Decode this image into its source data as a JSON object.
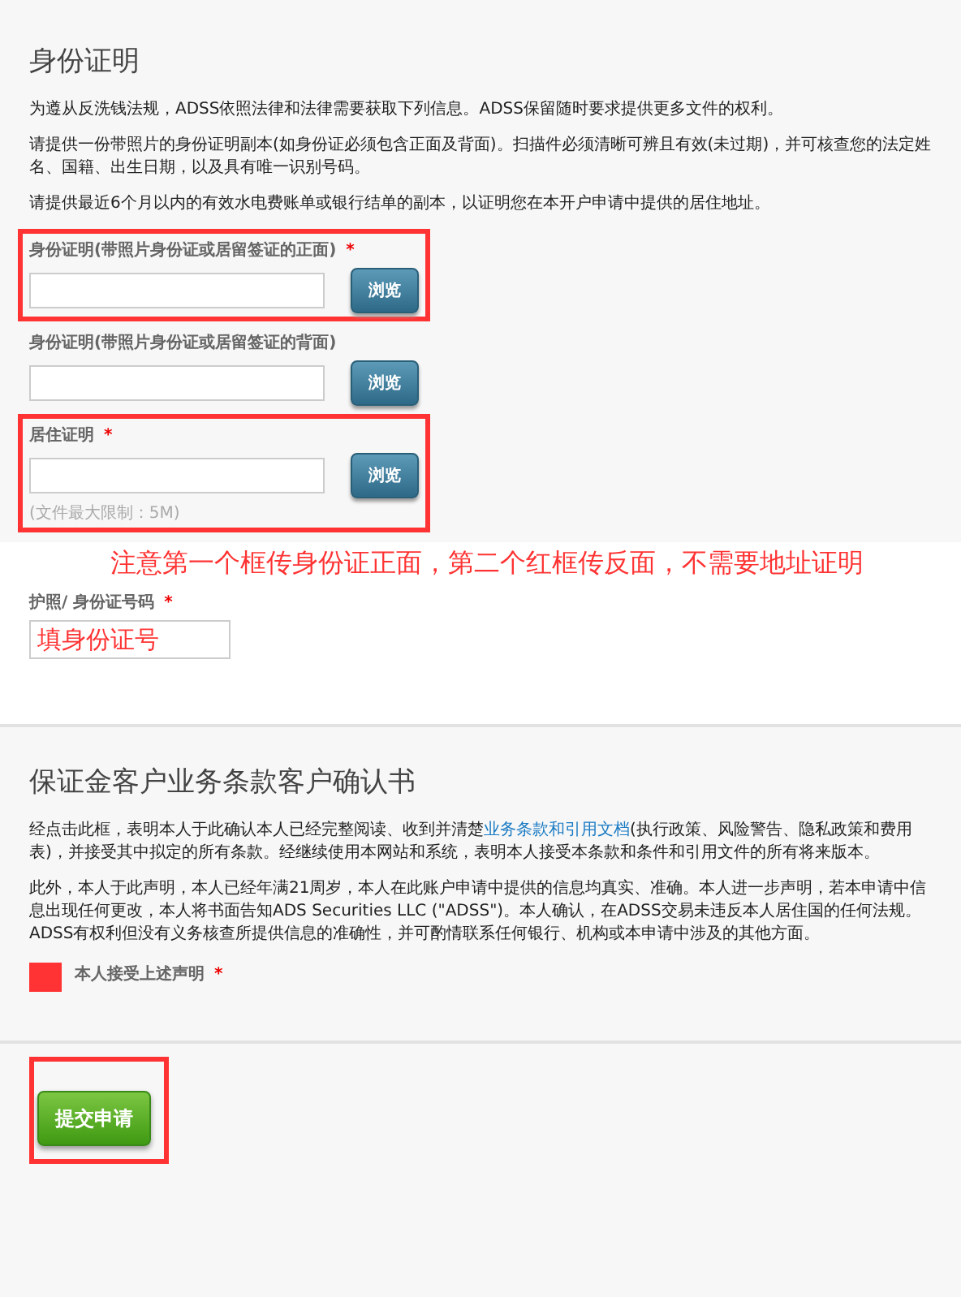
{
  "identity_section": {
    "title": "身份证明",
    "paragraphs": [
      "为遵从反洗钱法规，ADSS依照法律和法律需要获取下列信息。ADSS保留随时要求提供更多文件的权利。",
      "请提供一份带照片的身份证明副本(如身份证必须包含正面及背面)。扫描件必须清晰可辨且有效(未过期)，并可核查您的法定姓名、国籍、出生日期，以及具有唯一识别号码。",
      "请提供最近6个月以内的有效水电费账单或银行结单的副本，以证明您在本开户申请中提供的居住地址。"
    ],
    "uploads": [
      {
        "label": "身份证明(带照片身份证或居留签证的正面)",
        "required": true,
        "button": "浏览",
        "highlighted": true
      },
      {
        "label": "身份证明(带照片身份证或居留签证的背面)",
        "required": false,
        "button": "浏览",
        "highlighted": false
      },
      {
        "label": "居住证明",
        "required": true,
        "button": "浏览",
        "highlighted": true,
        "hint": "(文件最大限制：5M)"
      }
    ]
  },
  "id_section": {
    "annotation": "注意第一个框传身份证正面，第二个红框传反面，不需要地址证明",
    "label": "护照/ 身份证号码",
    "required": true,
    "value": "填身份证号"
  },
  "terms_section": {
    "title": "保证金客户业务条款客户确认书",
    "paragraph_1": {
      "before": "经点击此框，表明本人于此确认本人已经完整阅读、收到并清楚",
      "link": "业务条款和引用文档",
      "after": "(执行政策、风险警告、隐私政策和费用表)，并接受其中拟定的所有条款。经继续使用本网站和系统，表明本人接受本条款和条件和引用文件的所有将来版本。"
    },
    "paragraph_2": "此外，本人于此声明，本人已经年满21周岁，本人在此账户申请中提供的信息均真实、准确。本人进一步声明，若本申请中信息出现任何更改，本人将书面告知ADS Securities LLC (\"ADSS\")。本人确认，在ADSS交易未违反本人居住国的任何法规。ADSS有权利但没有义务核查所提供信息的准确性，并可酌情联系任何银行、机构或本申请中涉及的其他方面。",
    "agree_label": "本人接受上述声明",
    "agree_required": true
  },
  "required_mark": "*",
  "submit": {
    "label": "提交申请",
    "highlighted": true
  }
}
